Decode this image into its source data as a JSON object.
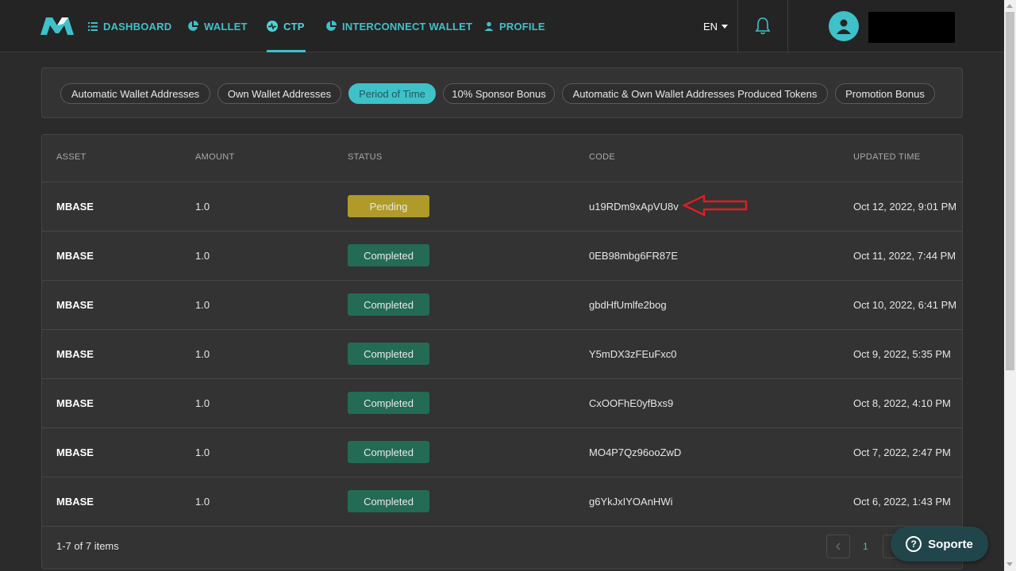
{
  "nav": {
    "items": [
      {
        "label": "DASHBOARD",
        "icon": "list-icon"
      },
      {
        "label": "WALLET",
        "icon": "pie-chart-icon"
      },
      {
        "label": "CTP",
        "icon": "pulse-icon",
        "active": true
      },
      {
        "label": "INTERCONNECT WALLET",
        "icon": "pie-chart-icon"
      },
      {
        "label": "PROFILE",
        "icon": "person-icon"
      }
    ],
    "language": "EN"
  },
  "filters": {
    "chips": [
      "Automatic Wallet Addresses",
      "Own Wallet Addresses",
      "Period of Time",
      "10% Sponsor Bonus",
      "Automatic & Own Wallet Addresses Produced Tokens",
      "Promotion Bonus"
    ],
    "active": "Period of Time"
  },
  "table": {
    "headers": [
      "ASSET",
      "AMOUNT",
      "STATUS",
      "CODE",
      "UPDATED TIME"
    ],
    "rows": [
      {
        "asset": "MBASE",
        "amount": "1.0",
        "status": "Pending",
        "code": "u19RDm9xApVU8v",
        "updated": "Oct 12, 2022, 9:01 PM"
      },
      {
        "asset": "MBASE",
        "amount": "1.0",
        "status": "Completed",
        "code": "0EB98mbg6FR87E",
        "updated": "Oct 11, 2022, 7:44 PM"
      },
      {
        "asset": "MBASE",
        "amount": "1.0",
        "status": "Completed",
        "code": "gbdHfUmlfe2bog",
        "updated": "Oct 10, 2022, 6:41 PM"
      },
      {
        "asset": "MBASE",
        "amount": "1.0",
        "status": "Completed",
        "code": "Y5mDX3zFEuFxc0",
        "updated": "Oct 9, 2022, 5:35 PM"
      },
      {
        "asset": "MBASE",
        "amount": "1.0",
        "status": "Completed",
        "code": "CxOOFhE0yfBxs9",
        "updated": "Oct 8, 2022, 4:10 PM"
      },
      {
        "asset": "MBASE",
        "amount": "1.0",
        "status": "Completed",
        "code": "MO4P7Qz96ooZwD",
        "updated": "Oct 7, 2022, 2:47 PM"
      },
      {
        "asset": "MBASE",
        "amount": "1.0",
        "status": "Completed",
        "code": "g6YkJxIYOAnHWi",
        "updated": "Oct 6, 2022, 1:43 PM"
      }
    ],
    "footer": "1-7 of 7 items",
    "current_page": "1"
  },
  "support": {
    "label": "Soporte"
  },
  "colors": {
    "accent": "#3fc1c9",
    "pending": "#b09a29",
    "completed": "#236b55",
    "annotation": "#e01e1e"
  }
}
